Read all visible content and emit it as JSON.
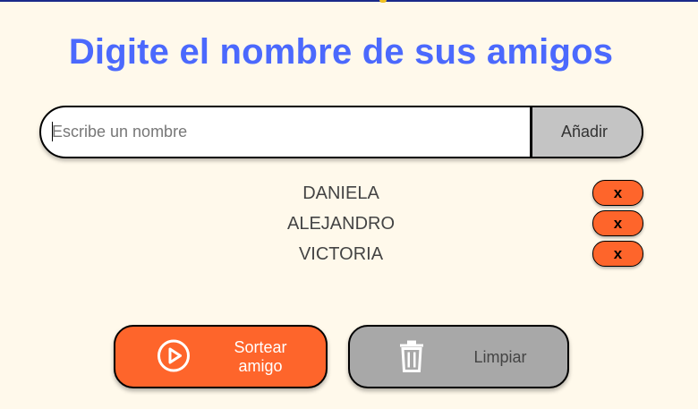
{
  "header": {
    "title": "Digite el nombre de sus amigos"
  },
  "input": {
    "placeholder": "Escribe un nombre",
    "value": ""
  },
  "add_button": {
    "label": "Añadir"
  },
  "friends": [
    {
      "name": "DANIELA",
      "remove_label": "x"
    },
    {
      "name": "ALEJANDRO",
      "remove_label": "x"
    },
    {
      "name": "VICTORIA",
      "remove_label": "x"
    }
  ],
  "draw_button": {
    "label": "Sortear amigo",
    "icon": "play-circle-icon"
  },
  "clear_button": {
    "label": "Limpiar",
    "icon": "trash-icon"
  },
  "colors": {
    "background": "#FFF9EB",
    "title": "#4B69FD",
    "accent_orange": "#FE652B",
    "gray_button": "#A8A8A8",
    "add_button": "#C4C4C4"
  }
}
